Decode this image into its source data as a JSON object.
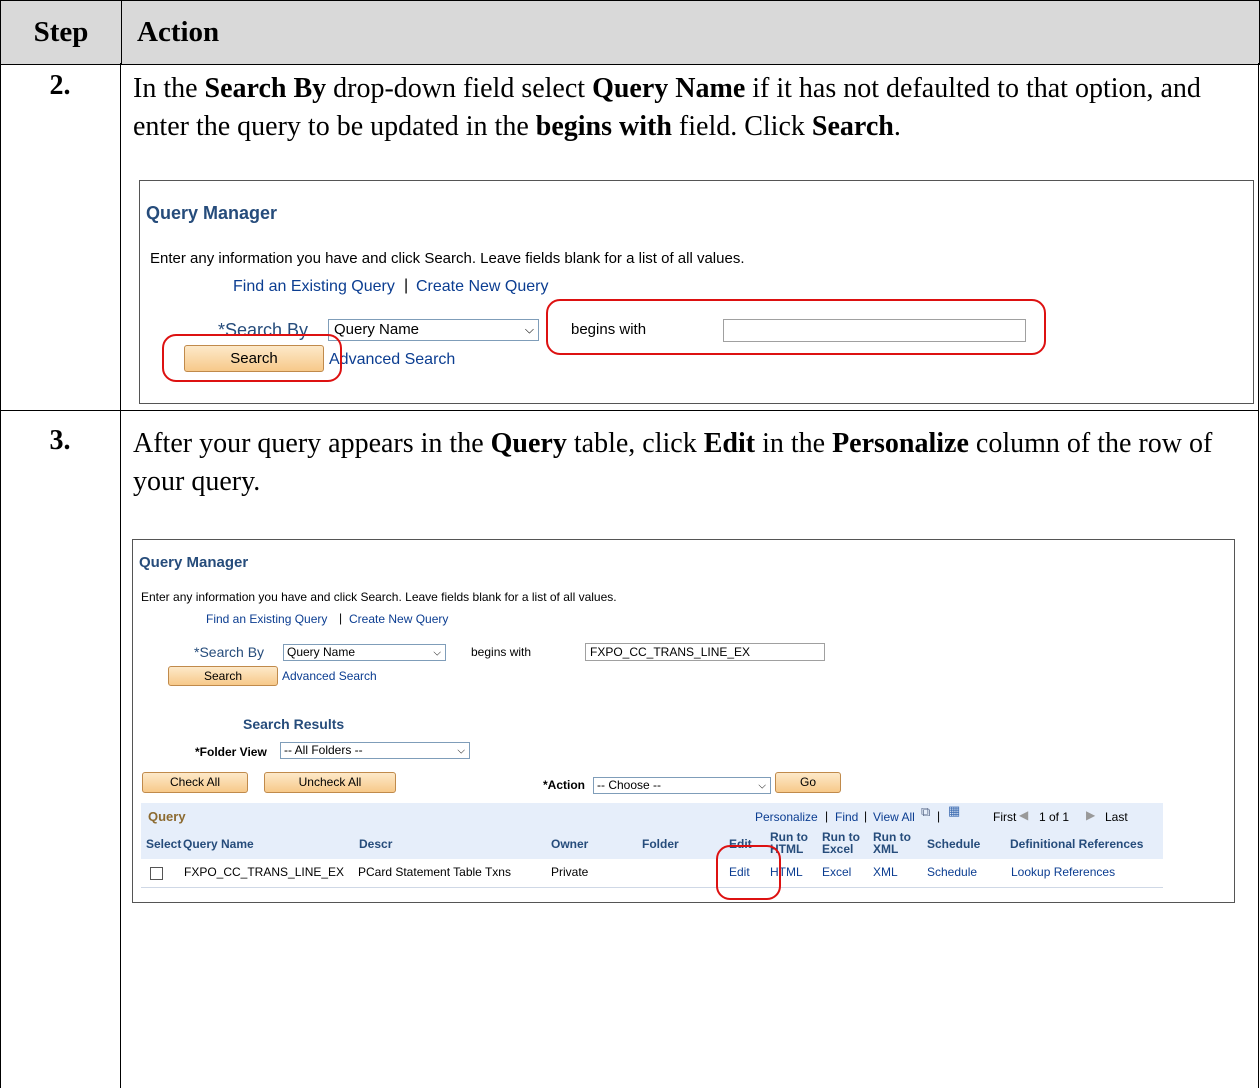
{
  "table_header": {
    "step": "Step",
    "action": "Action"
  },
  "rows": [
    {
      "step": "2.",
      "instruction_parts": [
        {
          "t": "In the ",
          "b": false
        },
        {
          "t": "Search By",
          "b": true
        },
        {
          "t": " drop-down field select ",
          "b": false
        },
        {
          "t": "Query Name",
          "b": true
        },
        {
          "t": " if it has not defaulted to that option, and enter the query to be updated in the ",
          "b": false
        },
        {
          "t": "begins with",
          "b": true
        },
        {
          "t": " field. Click ",
          "b": false
        },
        {
          "t": "Search",
          "b": true
        },
        {
          "t": ".",
          "b": false
        }
      ]
    },
    {
      "step": "3.",
      "instruction_parts": [
        {
          "t": "After your query appears in the ",
          "b": false
        },
        {
          "t": "Query",
          "b": true
        },
        {
          "t": " table, click ",
          "b": false
        },
        {
          "t": "Edit",
          "b": true
        },
        {
          "t": " in the ",
          "b": false
        },
        {
          "t": "Personalize",
          "b": true
        },
        {
          "t": " column of the row of your query.",
          "b": false
        }
      ]
    }
  ],
  "shot1": {
    "title": "Query Manager",
    "intro": "Enter any information you have and click Search. Leave fields blank for a list of all values.",
    "find_link": "Find an Existing Query",
    "sep": "|",
    "create_link": "Create New Query",
    "search_by_label": "*Search By",
    "search_by_value": "Query Name",
    "begins_with_label": "begins with",
    "begins_with_value": "",
    "search_button": "Search",
    "advanced_link": "Advanced Search"
  },
  "shot2": {
    "title": "Query Manager",
    "intro": "Enter any information you have and click Search. Leave fields blank for a list of all values.",
    "find_link": "Find an Existing Query",
    "sep": "|",
    "create_link": "Create New Query",
    "search_by_label": "*Search By",
    "search_by_value": "Query Name",
    "begins_with_label": "begins with",
    "begins_with_value": "FXPO_CC_TRANS_LINE_EX",
    "search_button": "Search",
    "advanced_link": "Advanced Search",
    "results_title": "Search Results",
    "folder_view_label": "*Folder View",
    "folder_view_value": "-- All Folders --",
    "check_all": "Check All",
    "uncheck_all": "Uncheck All",
    "action_label": "*Action",
    "action_value": "-- Choose --",
    "go_button": "Go",
    "grid_title": "Query",
    "personalize": "Personalize",
    "find": "Find",
    "view_all": "View All",
    "first": "First",
    "pager": "1 of 1",
    "last": "Last",
    "columns": [
      "Select",
      "Query Name",
      "Descr",
      "Owner",
      "Folder",
      "Edit",
      "Run to HTML",
      "Run to Excel",
      "Run to XML",
      "Schedule",
      "Definitional References"
    ],
    "row": {
      "query_name": "FXPO_CC_TRANS_LINE_EX",
      "descr": "PCard Statement Table Txns",
      "owner": "Private",
      "folder": "",
      "edit": "Edit",
      "html": "HTML",
      "excel": "Excel",
      "xml": "XML",
      "schedule": "Schedule",
      "refs": "Lookup References"
    }
  }
}
